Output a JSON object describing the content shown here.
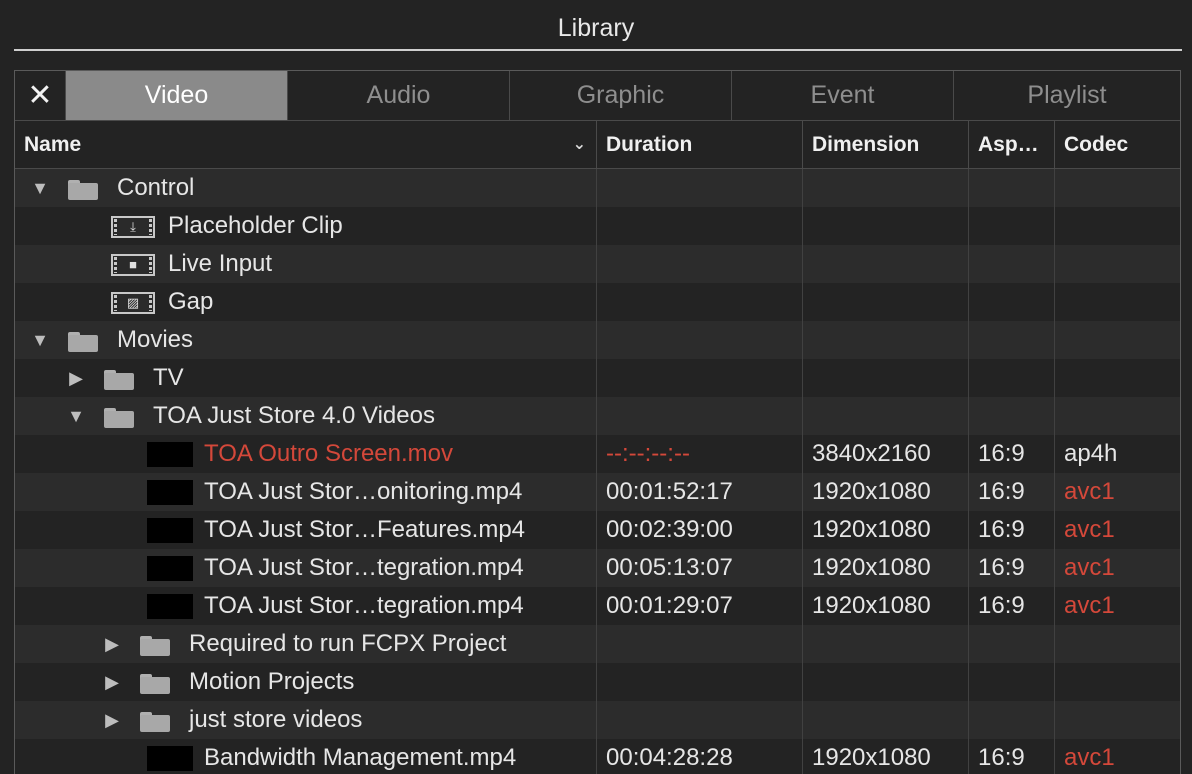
{
  "window": {
    "title": "Library"
  },
  "tabs": [
    {
      "label": "Video",
      "active": true
    },
    {
      "label": "Audio",
      "active": false
    },
    {
      "label": "Graphic",
      "active": false
    },
    {
      "label": "Event",
      "active": false
    },
    {
      "label": "Playlist",
      "active": false
    }
  ],
  "close_icon": "✕",
  "columns": {
    "name": "Name",
    "duration": "Duration",
    "dimension": "Dimension",
    "aspect": "Asp…",
    "codec": "Codec"
  },
  "colors": {
    "error_red": "#d4483a",
    "active_tab": "#8a8a8a"
  },
  "rows": [
    {
      "type": "folder",
      "level": 0,
      "expanded": true,
      "name": "Control",
      "duration": "",
      "dimension": "",
      "aspect": "",
      "codec": ""
    },
    {
      "type": "clip",
      "icon": "placeholder-icon",
      "level": 1,
      "name": "Placeholder Clip",
      "duration": "",
      "dimension": "",
      "aspect": "",
      "codec": ""
    },
    {
      "type": "clip",
      "icon": "camera-icon",
      "level": 1,
      "name": "Live Input",
      "duration": "",
      "dimension": "",
      "aspect": "",
      "codec": ""
    },
    {
      "type": "clip",
      "icon": "gap-icon",
      "level": 1,
      "name": "Gap",
      "duration": "",
      "dimension": "",
      "aspect": "",
      "codec": ""
    },
    {
      "type": "folder",
      "level": 0,
      "expanded": true,
      "name": "Movies",
      "duration": "",
      "dimension": "",
      "aspect": "",
      "codec": ""
    },
    {
      "type": "folder",
      "level": 1,
      "expanded": false,
      "name": "TV",
      "duration": "",
      "dimension": "",
      "aspect": "",
      "codec": ""
    },
    {
      "type": "folder",
      "level": 1,
      "expanded": true,
      "name": "TOA Just Store 4.0 Videos",
      "duration": "",
      "dimension": "",
      "aspect": "",
      "codec": ""
    },
    {
      "type": "video",
      "level": 2,
      "name": "TOA Outro Screen.mov",
      "name_red": true,
      "duration": "--:--:--:--",
      "duration_red": true,
      "dimension": "3840x2160",
      "aspect": "16:9",
      "codec": "ap4h",
      "codec_red": false
    },
    {
      "type": "video",
      "level": 2,
      "name": "TOA Just Stor…onitoring.mp4",
      "name_red": false,
      "duration": "00:01:52:17",
      "duration_red": false,
      "dimension": "1920x1080",
      "aspect": "16:9",
      "codec": "avc1",
      "codec_red": true
    },
    {
      "type": "video",
      "level": 2,
      "name": "TOA Just Stor…Features.mp4",
      "name_red": false,
      "duration": "00:02:39:00",
      "duration_red": false,
      "dimension": "1920x1080",
      "aspect": "16:9",
      "codec": "avc1",
      "codec_red": true
    },
    {
      "type": "video",
      "level": 2,
      "name": "TOA Just Stor…tegration.mp4",
      "name_red": false,
      "duration": "00:05:13:07",
      "duration_red": false,
      "dimension": "1920x1080",
      "aspect": "16:9",
      "codec": "avc1",
      "codec_red": true
    },
    {
      "type": "video",
      "level": 2,
      "name": "TOA Just Stor…tegration.mp4",
      "name_red": false,
      "duration": "00:01:29:07",
      "duration_red": false,
      "dimension": "1920x1080",
      "aspect": "16:9",
      "codec": "avc1",
      "codec_red": true
    },
    {
      "type": "folder",
      "level": 2,
      "expanded": false,
      "name": "Required to run FCPX Project",
      "duration": "",
      "dimension": "",
      "aspect": "",
      "codec": ""
    },
    {
      "type": "folder",
      "level": 2,
      "expanded": false,
      "name": "Motion Projects",
      "duration": "",
      "dimension": "",
      "aspect": "",
      "codec": ""
    },
    {
      "type": "folder",
      "level": 2,
      "expanded": false,
      "name": "just store videos",
      "duration": "",
      "dimension": "",
      "aspect": "",
      "codec": ""
    },
    {
      "type": "video",
      "level": 2,
      "name": "Bandwidth Management.mp4",
      "name_red": false,
      "duration": "00:04:28:28",
      "duration_red": false,
      "dimension": "1920x1080",
      "aspect": "16:9",
      "codec": "avc1",
      "codec_red": true
    }
  ]
}
